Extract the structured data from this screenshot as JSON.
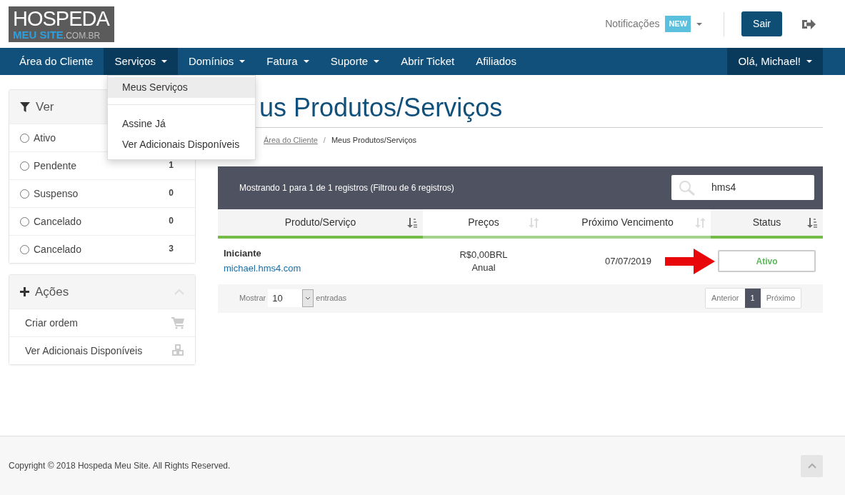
{
  "header": {
    "logo": {
      "top": "HOSPEDA",
      "brand": "MEU SITE",
      "suffix": ".COM.BR"
    },
    "notifications": {
      "label": "Notificações",
      "badge": "NEW"
    },
    "logout_button": "Sair"
  },
  "nav": {
    "items": [
      {
        "label": "Área do Cliente",
        "caret": false,
        "expanded": false
      },
      {
        "label": "Serviços",
        "caret": true,
        "expanded": true
      },
      {
        "label": "Domínios",
        "caret": true,
        "expanded": false
      },
      {
        "label": "Fatura",
        "caret": true,
        "expanded": false
      },
      {
        "label": "Suporte",
        "caret": true,
        "expanded": false
      },
      {
        "label": "Abrir Ticket",
        "caret": false,
        "expanded": false
      },
      {
        "label": "Afiliados",
        "caret": false,
        "expanded": false
      }
    ],
    "user_menu": {
      "label": "Olá, Michael!",
      "caret": true
    }
  },
  "dropdown": {
    "groups": [
      [
        {
          "label": "Meus Serviços",
          "selected": true
        }
      ],
      [
        {
          "label": "Assine Já",
          "selected": false
        },
        {
          "label": "Ver Adicionais Disponíveis",
          "selected": false
        }
      ]
    ]
  },
  "sidebar": {
    "filter": {
      "title": "Ver",
      "items": [
        {
          "label": "Ativo",
          "selected": false
        },
        {
          "label": "Pendente",
          "count": "1",
          "selected": false
        },
        {
          "label": "Suspenso",
          "count": "0",
          "selected": false
        },
        {
          "label": "Cancelado",
          "count": "0",
          "selected": false
        },
        {
          "label": "Cancelado",
          "count": "3",
          "selected": false
        }
      ]
    },
    "actions": {
      "title": "Ações",
      "items": [
        {
          "label": "Criar ordem",
          "kind": "cart"
        },
        {
          "label": "Ver Adicionais Disponíveis",
          "kind": "cubes"
        }
      ]
    }
  },
  "page": {
    "title": "us Produtos/Serviços",
    "breadcrumb": {
      "separator": "/",
      "items": [
        "Área do Cliente",
        "Meus Produtos/Serviços"
      ]
    }
  },
  "table": {
    "info": "Mostrando 1 para 1 de 1 registros (Filtrou de 6 registros)",
    "search": {
      "value": "hms4"
    },
    "columns": [
      {
        "label": "Produto/Serviço",
        "sorted": true
      },
      {
        "label": "Preços",
        "sorted": false
      },
      {
        "label": "Próximo Vencimento",
        "sorted": false
      },
      {
        "label": "Status",
        "sorted": true
      }
    ],
    "rows": [
      {
        "product": "Iniciante",
        "domain": "michael.hms4.com",
        "price": "R$0,00BRL",
        "cycle": "Anual",
        "due": "07/07/2019",
        "status": "Ativo"
      }
    ],
    "length": {
      "label_before": "Mostrar",
      "value": "10",
      "label_after": "entradas"
    },
    "pagination": [
      {
        "label": "Anterior",
        "selected": false
      },
      {
        "label": "1",
        "selected": true
      },
      {
        "label": "Próximo",
        "selected": false
      }
    ]
  },
  "footer": {
    "copyright": "Copyright © 2018 Hospeda Meu Site. All Rights Reserved."
  }
}
